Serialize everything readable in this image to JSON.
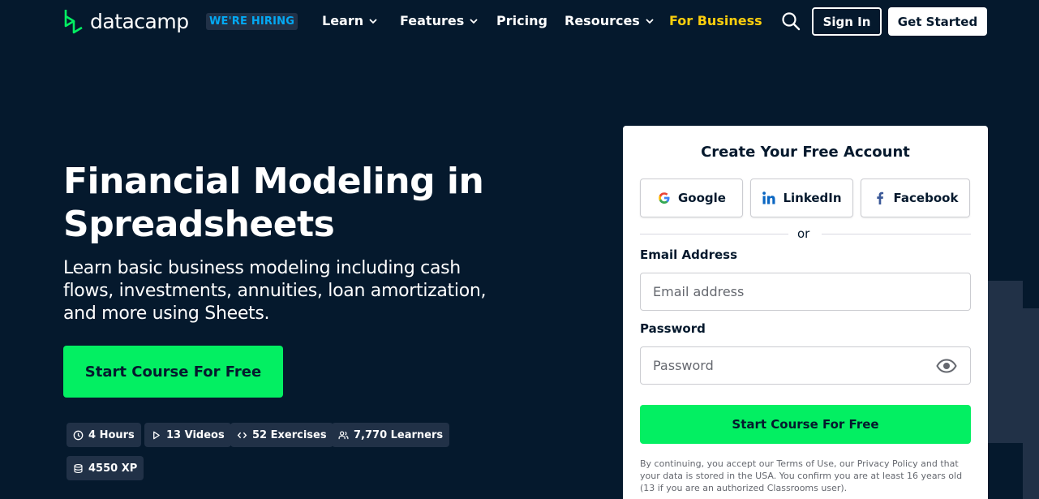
{
  "nav": {
    "logo_text": "datacamp",
    "hiring_badge": "WE'RE HIRING",
    "items": [
      {
        "label": "Learn"
      },
      {
        "label": "Features"
      },
      {
        "label": "Pricing"
      },
      {
        "label": "Resources"
      },
      {
        "label": "For Business"
      }
    ],
    "sign_in": "Sign In",
    "get_started": "Get Started"
  },
  "hero": {
    "title_line1": "Financial Modeling in",
    "title_line2": "Spreadsheets",
    "subtitle_line1": "Learn basic business modeling including cash",
    "subtitle_line2": "flows, investments, annuities, loan amortization,",
    "subtitle_line3": "and more using Sheets.",
    "cta": "Start Course For Free",
    "stats": [
      {
        "icon": "clock-icon",
        "label": "4 Hours"
      },
      {
        "icon": "play-icon",
        "label": "13 Videos"
      },
      {
        "icon": "code-icon",
        "label": "52 Exercises"
      },
      {
        "icon": "users-icon",
        "label": "7,770 Learners"
      },
      {
        "icon": "database-icon",
        "label": "4550 XP"
      }
    ]
  },
  "signup": {
    "title": "Create Your Free Account",
    "google": "Google",
    "linkedin": "LinkedIn",
    "facebook": "Facebook",
    "or": "or",
    "email_label": "Email Address",
    "email_placeholder": "Email address",
    "password_label": "Password",
    "password_placeholder": "Password",
    "submit": "Start Course For Free",
    "legal_line1": "By continuing, you accept our Terms of Use, our Privacy Policy and that",
    "legal_line2": "your data is stored in the USA. You confirm you are at least 16 years old",
    "legal_line3": "(13 if you are an authorized Classrooms user)."
  },
  "colors": {
    "background": "#05192d",
    "brand_green": "#03ef62",
    "business_yellow": "#fcce0d",
    "hiring_blue": "#03a9f4",
    "chip_bg": "#213147"
  }
}
